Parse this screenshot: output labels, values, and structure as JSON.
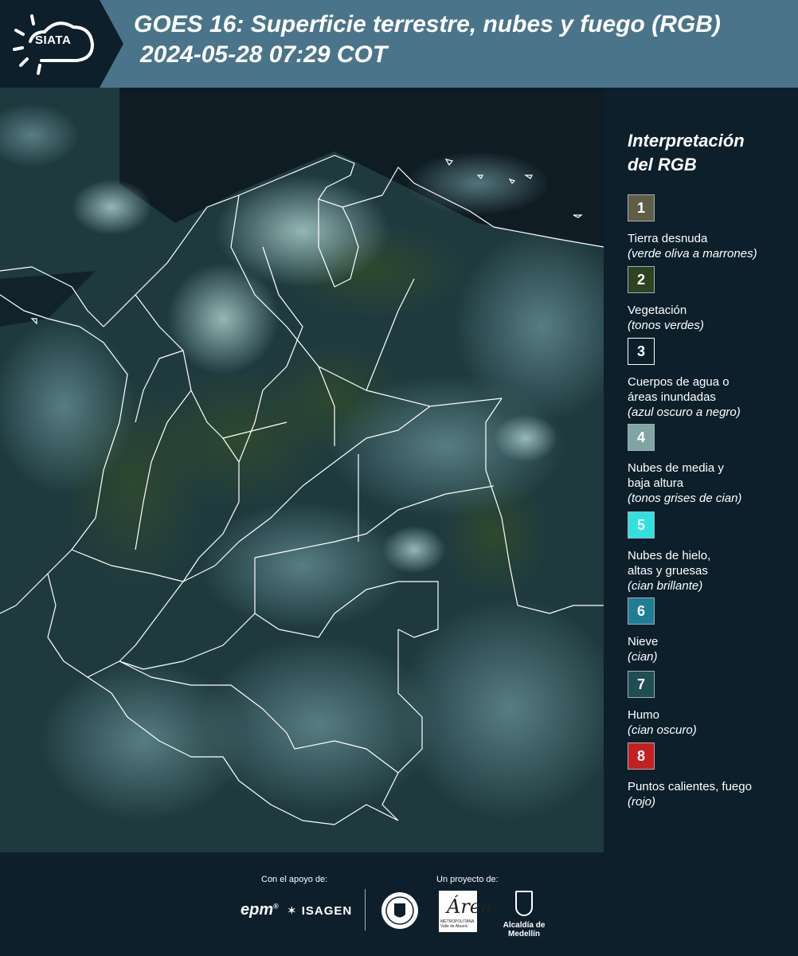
{
  "header": {
    "brand": "SIATA",
    "title_line1": "GOES 16: Superficie terrestre, nubes y fuego (RGB)",
    "title_line2": "2024-05-28 07:29 COT"
  },
  "map": {
    "icon": "satellite-map-image",
    "colors": {
      "background": "#1f3a3f",
      "vegetation": "#2f4a2c",
      "cloud": "#9fc7c7",
      "border_line": "#ffffff"
    }
  },
  "legend": {
    "title_line1": "Interpretación",
    "title_line2": "del RGB",
    "items": [
      {
        "number": "1",
        "color": "#5f5e45",
        "label": "Tierra desnuda",
        "sub": "(verde oliva a marrones)"
      },
      {
        "number": "2",
        "color": "#2f4221",
        "label": "Vegetación",
        "sub": "(tonos verdes)"
      },
      {
        "number": "3",
        "color": "#0d1f2b",
        "label": "Cuerpos de agua o áreas inundadas",
        "sub": "(azul oscuro a negro)"
      },
      {
        "number": "4",
        "color": "#7fa5a5",
        "label": "Nubes de media y baja altura",
        "sub": "(tonos grises de cian)"
      },
      {
        "number": "5",
        "color": "#33e0e0",
        "label": "Nubes de hielo, altas y gruesas",
        "sub": "(cian brillante)"
      },
      {
        "number": "6",
        "color": "#1f7d96",
        "label": "Nieve",
        "sub": "(cian)"
      },
      {
        "number": "7",
        "color": "#1e4d52",
        "label": "Humo",
        "sub": "(cian oscuro)"
      },
      {
        "number": "8",
        "color": "#c42020",
        "label": "Puntos calientes, fuego",
        "sub": "(rojo)"
      }
    ]
  },
  "footer": {
    "support_label": "Con el apoyo de:",
    "project_label": "Un proyecto de:",
    "epm": "epm",
    "epm_mark": "®",
    "isagen": "ISAGEN",
    "area_logo_letter": "Área",
    "area_logo_sub": "METROPOLITANA Valle de Aburrá",
    "alcaldia": "Alcaldía de Medellín"
  }
}
